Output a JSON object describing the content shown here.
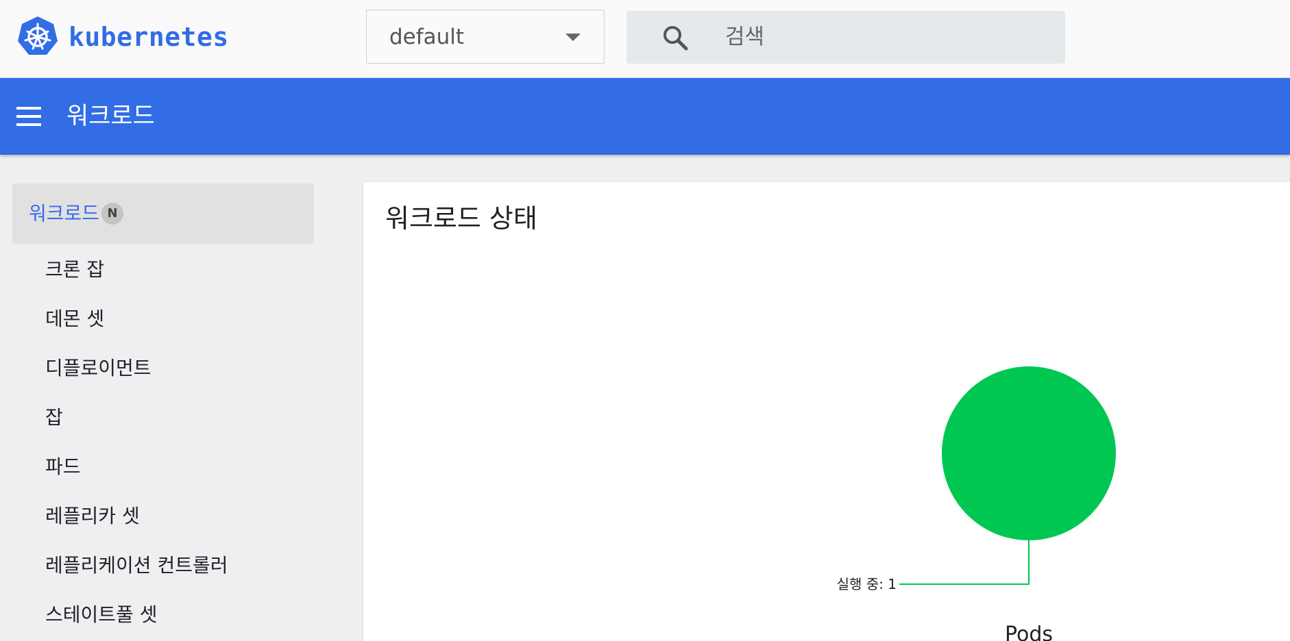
{
  "header": {
    "brand": "kubernetes",
    "namespace_selector": {
      "value": "default"
    },
    "search": {
      "placeholder": "검색"
    }
  },
  "appbar": {
    "title": "워크로드"
  },
  "sidebar": {
    "section": {
      "label": "워크로드",
      "badge": "N"
    },
    "items": [
      {
        "label": "크론 잡"
      },
      {
        "label": "데몬 셋"
      },
      {
        "label": "디플로이먼트"
      },
      {
        "label": "잡"
      },
      {
        "label": "파드"
      },
      {
        "label": "레플리카 셋"
      },
      {
        "label": "레플리케이션 컨트롤러"
      },
      {
        "label": "스테이트풀 셋"
      }
    ]
  },
  "main": {
    "card_title": "워크로드 상태"
  },
  "colors": {
    "brand_blue": "#326de6",
    "running_green": "#00c752"
  },
  "chart_data": {
    "type": "pie",
    "title": "Pods",
    "slices": [
      {
        "label": "실행 중",
        "value": 1,
        "color": "#00c752"
      }
    ],
    "annotation": "실행 중: 1"
  }
}
